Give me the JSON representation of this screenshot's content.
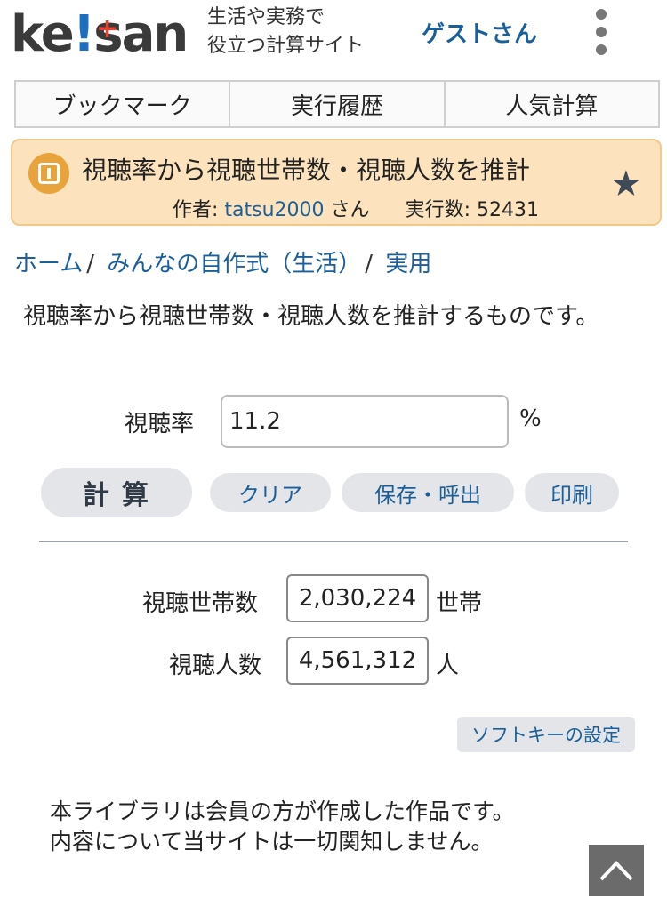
{
  "header": {
    "logo_text": "ke!san",
    "tagline_line1": "生活や実務で",
    "tagline_line2": "役立つ計算サイト",
    "user_label": "ゲストさん",
    "menu_icon": "kebab-menu-icon"
  },
  "tabs": [
    {
      "label": "ブックマーク"
    },
    {
      "label": "実行履歴"
    },
    {
      "label": "人気計算"
    }
  ],
  "calc_header": {
    "title": "視聴率から視聴世帯数・視聴人数を推計",
    "author_prefix": "作者:",
    "author_name": "tatsu2000",
    "author_suffix": "さん",
    "run_count_label": "実行数:",
    "run_count": "52431",
    "star_icon": "star-icon",
    "colors": {
      "background": "#fde3bd",
      "border": "#f2c88b",
      "icon": "#e8a33d"
    }
  },
  "breadcrumb": [
    {
      "label": "ホーム"
    },
    {
      "label": "みんなの自作式（生活）"
    },
    {
      "label": "実用"
    }
  ],
  "description": "視聴率から視聴世帯数・視聴人数を推計するものです。",
  "form": {
    "rate_label": "視聴率",
    "rate_value": "11.2",
    "rate_unit": "%"
  },
  "buttons": {
    "calc": "計算",
    "clear": "クリア",
    "save": "保存・呼出",
    "print": "印刷"
  },
  "results": [
    {
      "label": "視聴世帯数",
      "value": "2,030,224",
      "unit": "世帯"
    },
    {
      "label": "視聴人数",
      "value": "4,561,312",
      "unit": "人"
    }
  ],
  "softkey_label": "ソフトキーの設定",
  "notice_line1": "本ライブラリは会員の方が作成した作品です。",
  "notice_line2": "内容について当サイトは一切関知しません。",
  "scroll_top_icon": "chevron-up-icon"
}
